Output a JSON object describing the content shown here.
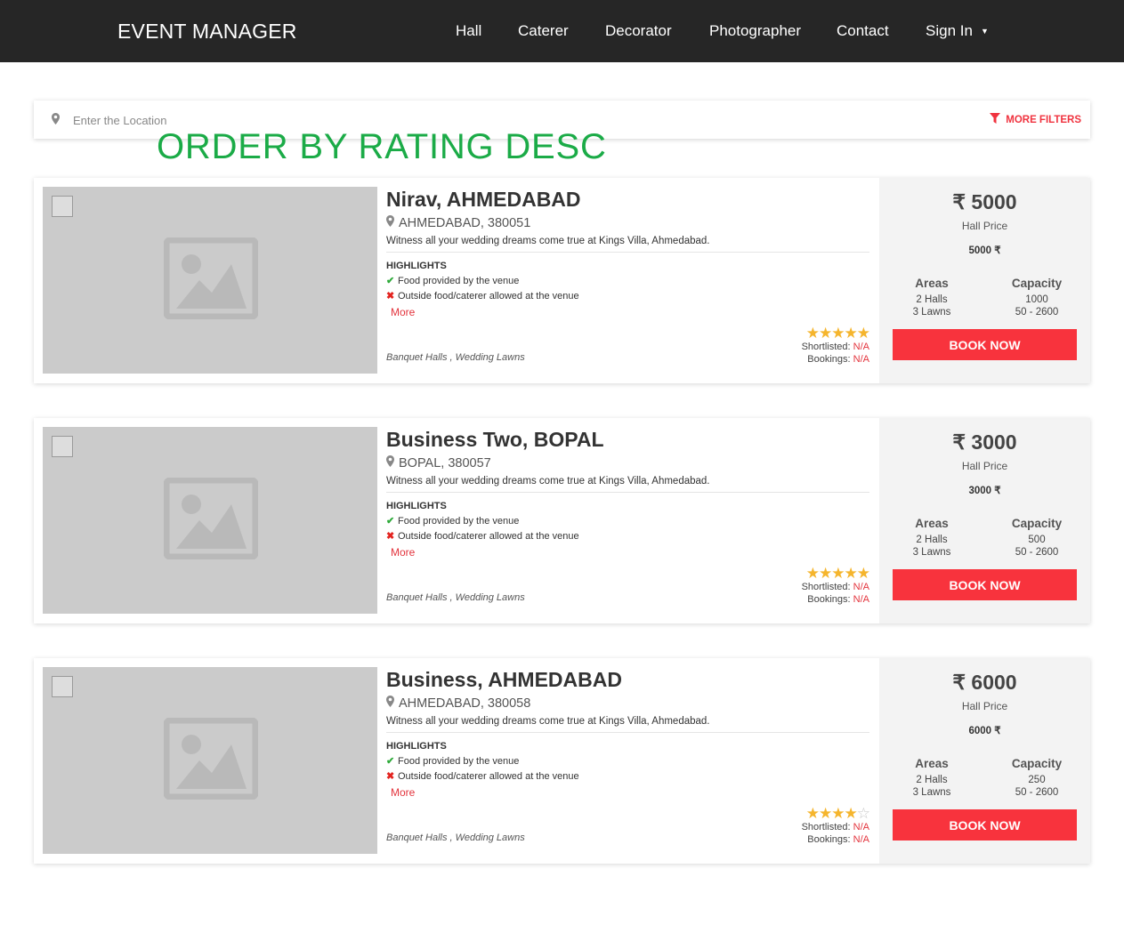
{
  "nav": {
    "brand": "EVENT MANAGER",
    "items": [
      "Hall",
      "Caterer",
      "Decorator",
      "Photographer",
      "Contact",
      "Sign In"
    ]
  },
  "search": {
    "placeholder": "Enter the Location",
    "more_filters": "MORE FILTERS"
  },
  "overlay_title": "ORDER BY RATING DESC",
  "listings": [
    {
      "title": "Nirav, AHMEDABAD",
      "location": "AHMEDABAD, 380051",
      "description": "Witness all your wedding dreams come true at Kings Villa, Ahmedabad.",
      "highlights_title": "HIGHLIGHTS",
      "highlight_yes": "Food provided by the venue",
      "highlight_no": "Outside food/caterer allowed at the venue",
      "more": "More",
      "categories": "Banquet Halls , Wedding Lawns",
      "rating": 5,
      "shortlisted_label": "Shortlisted:",
      "shortlisted": "N/A",
      "bookings_label": "Bookings:",
      "bookings": "N/A",
      "price": "₹ 5000",
      "price_label": "Hall Price",
      "price_small": "5000 ₹",
      "areas_label": "Areas",
      "areas": [
        "2 Halls",
        "3 Lawns"
      ],
      "capacity_label": "Capacity",
      "capacity": [
        "1000",
        "50 - 2600"
      ],
      "book": "BOOK NOW"
    },
    {
      "title": "Business Two, BOPAL",
      "location": "BOPAL, 380057",
      "description": "Witness all your wedding dreams come true at Kings Villa, Ahmedabad.",
      "highlights_title": "HIGHLIGHTS",
      "highlight_yes": "Food provided by the venue",
      "highlight_no": "Outside food/caterer allowed at the venue",
      "more": "More",
      "categories": "Banquet Halls , Wedding Lawns",
      "rating": 5,
      "shortlisted_label": "Shortlisted:",
      "shortlisted": "N/A",
      "bookings_label": "Bookings:",
      "bookings": "N/A",
      "price": "₹ 3000",
      "price_label": "Hall Price",
      "price_small": "3000 ₹",
      "areas_label": "Areas",
      "areas": [
        "2 Halls",
        "3 Lawns"
      ],
      "capacity_label": "Capacity",
      "capacity": [
        "500",
        "50 - 2600"
      ],
      "book": "BOOK NOW"
    },
    {
      "title": "Business, AHMEDABAD",
      "location": "AHMEDABAD, 380058",
      "description": "Witness all your wedding dreams come true at Kings Villa, Ahmedabad.",
      "highlights_title": "HIGHLIGHTS",
      "highlight_yes": "Food provided by the venue",
      "highlight_no": "Outside food/caterer allowed at the venue",
      "more": "More",
      "categories": "Banquet Halls , Wedding Lawns",
      "rating": 4,
      "shortlisted_label": "Shortlisted:",
      "shortlisted": "N/A",
      "bookings_label": "Bookings:",
      "bookings": "N/A",
      "price": "₹ 6000",
      "price_label": "Hall Price",
      "price_small": "6000 ₹",
      "areas_label": "Areas",
      "areas": [
        "2 Halls",
        "3 Lawns"
      ],
      "capacity_label": "Capacity",
      "capacity": [
        "250",
        "50 - 2600"
      ],
      "book": "BOOK NOW"
    }
  ],
  "colors": {
    "navbar": "#262626",
    "accent": "#f8333d",
    "overlay": "#1bab47",
    "star": "#f5b52d"
  }
}
